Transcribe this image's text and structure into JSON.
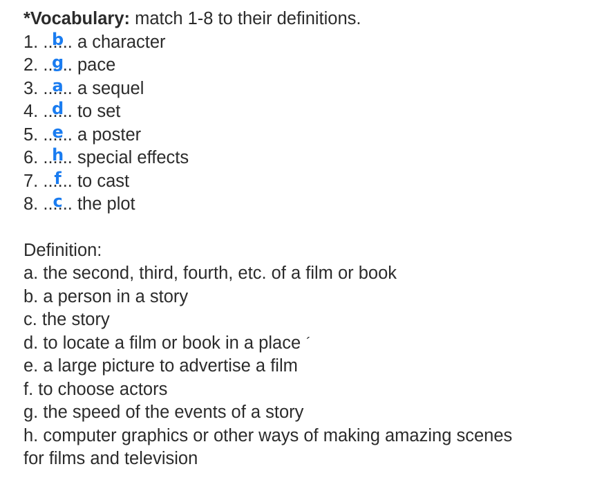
{
  "title": {
    "bold": "*Vocabulary:",
    "rest": " match 1-8 to their definitions."
  },
  "items": [
    {
      "num": "1.",
      "dots": "......",
      "answer": "b",
      "term": " a character"
    },
    {
      "num": "2.",
      "dots": "......",
      "answer": "g",
      "term": " pace"
    },
    {
      "num": "3.",
      "dots": "......",
      "answer": "a",
      "term": " a sequel"
    },
    {
      "num": "4.",
      "dots": "......",
      "answer": "d",
      "term": " to set"
    },
    {
      "num": "5.",
      "dots": "......",
      "answer": "e",
      "term": " a poster"
    },
    {
      "num": "6.",
      "dots": "......",
      "answer": "h",
      "term": " special effects"
    },
    {
      "num": "7.",
      "dots": "......",
      "answer": "f",
      "term": " to cast"
    },
    {
      "num": "8.",
      "dots": "......",
      "answer": "c",
      "term": " the plot"
    }
  ],
  "definitions_heading": "Definition:",
  "definitions": [
    "a. the second, third, fourth, etc. of a film or book",
    "b. a person in a story",
    "c. the story",
    "d. to locate a film or book in a place",
    "e. a large picture to advertise a film",
    "f. to choose actors",
    "g. the speed of the events of a story",
    "h. computer graphics or other ways of making amazing scenes",
    "for films and television"
  ],
  "stray_mark": "´",
  "colors": {
    "text": "#2b2b2b",
    "handwriting": "#1a7cf0"
  }
}
